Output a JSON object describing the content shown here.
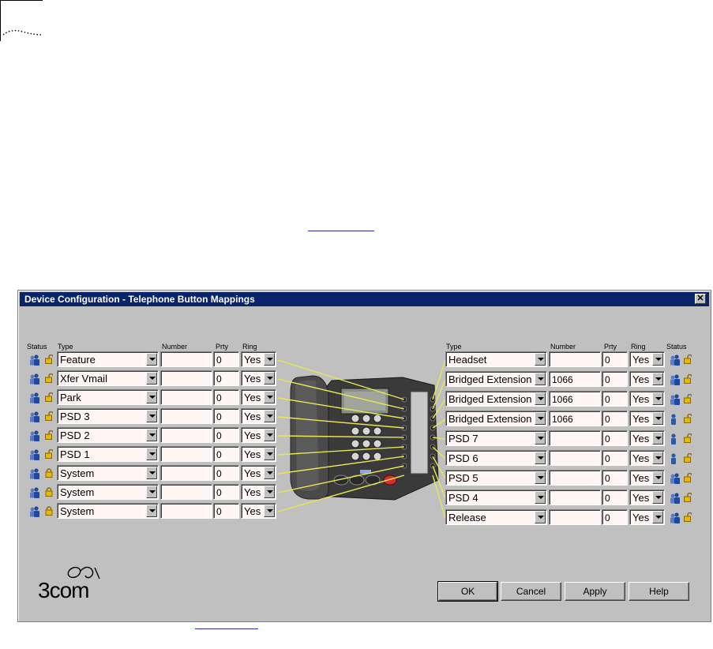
{
  "window": {
    "title": "Device Configuration - Telephone Button Mappings",
    "close_label": "✕"
  },
  "left_headers": {
    "status": "Status",
    "type": "Type",
    "number": "Number",
    "prty": "Prty",
    "ring": "Ring"
  },
  "right_headers": {
    "type": "Type",
    "number": "Number",
    "prty": "Prty",
    "ring": "Ring",
    "status": "Status"
  },
  "left_rows": [
    {
      "type": "Feature",
      "number": "",
      "prty": "0",
      "ring": "Yes",
      "status_icon": "users-icon",
      "lock_icon": "unlocked-icon"
    },
    {
      "type": "Xfer Vmail",
      "number": "",
      "prty": "0",
      "ring": "Yes",
      "status_icon": "users-icon",
      "lock_icon": "unlocked-icon"
    },
    {
      "type": "Park",
      "number": "",
      "prty": "0",
      "ring": "Yes",
      "status_icon": "users-icon",
      "lock_icon": "unlocked-icon"
    },
    {
      "type": "PSD 3",
      "number": "",
      "prty": "0",
      "ring": "Yes",
      "status_icon": "users-icon",
      "lock_icon": "unlocked-icon"
    },
    {
      "type": "PSD 2",
      "number": "",
      "prty": "0",
      "ring": "Yes",
      "status_icon": "users-icon",
      "lock_icon": "unlocked-icon"
    },
    {
      "type": "PSD 1",
      "number": "",
      "prty": "0",
      "ring": "Yes",
      "status_icon": "users-icon",
      "lock_icon": "unlocked-icon"
    },
    {
      "type": "System",
      "number": "",
      "prty": "0",
      "ring": "Yes",
      "status_icon": "users-icon",
      "lock_icon": "locked-icon"
    },
    {
      "type": "System",
      "number": "",
      "prty": "0",
      "ring": "Yes",
      "status_icon": "users-icon",
      "lock_icon": "locked-icon"
    },
    {
      "type": "System",
      "number": "",
      "prty": "0",
      "ring": "Yes",
      "status_icon": "users-icon",
      "lock_icon": "locked-icon"
    }
  ],
  "right_rows": [
    {
      "type": "Headset",
      "number": "",
      "prty": "0",
      "ring": "Yes",
      "status_icon": "users-icon",
      "lock_icon": "unlocked-icon"
    },
    {
      "type": "Bridged Extension",
      "number": "1066",
      "prty": "0",
      "ring": "Yes",
      "status_icon": "users-icon",
      "lock_icon": "unlocked-icon"
    },
    {
      "type": "Bridged Extension",
      "number": "1066",
      "prty": "0",
      "ring": "Yes",
      "status_icon": "users-icon",
      "lock_icon": "unlocked-icon"
    },
    {
      "type": "Bridged Extension",
      "number": "1066",
      "prty": "0",
      "ring": "Yes",
      "status_icon": "user-icon",
      "lock_icon": "unlocked-icon"
    },
    {
      "type": "PSD 7",
      "number": "",
      "prty": "0",
      "ring": "Yes",
      "status_icon": "user-icon",
      "lock_icon": "unlocked-icon"
    },
    {
      "type": "PSD 6",
      "number": "",
      "prty": "0",
      "ring": "Yes",
      "status_icon": "user-icon",
      "lock_icon": "unlocked-icon"
    },
    {
      "type": "PSD 5",
      "number": "",
      "prty": "0",
      "ring": "Yes",
      "status_icon": "users-icon",
      "lock_icon": "unlocked-icon"
    },
    {
      "type": "PSD 4",
      "number": "",
      "prty": "0",
      "ring": "Yes",
      "status_icon": "users-icon",
      "lock_icon": "unlocked-icon"
    },
    {
      "type": "Release",
      "number": "",
      "prty": "0",
      "ring": "Yes",
      "status_icon": "users-icon",
      "lock_icon": "unlocked-icon"
    }
  ],
  "buttons": {
    "ok": "OK",
    "cancel": "Cancel",
    "apply": "Apply",
    "help": "Help"
  },
  "logo": {
    "text": "3com"
  },
  "colors": {
    "titlebar": "#0a246a",
    "window_bg": "#c0c0c0",
    "field_bg": "#fff5f5",
    "connector": "#e8e850",
    "link": "#2b2bd0"
  }
}
